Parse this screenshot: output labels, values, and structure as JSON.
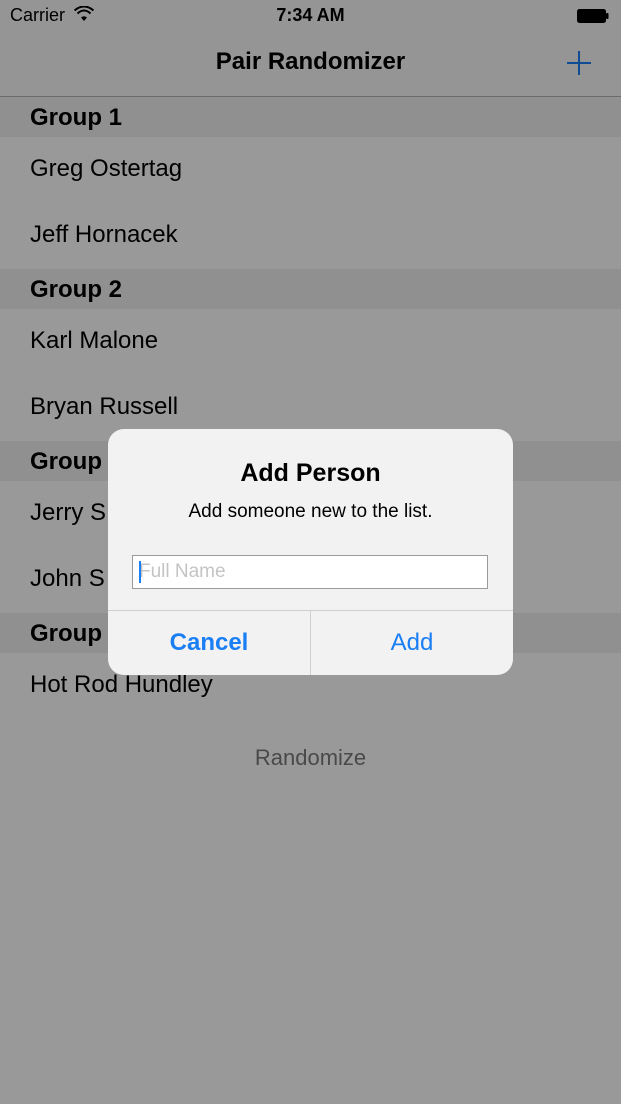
{
  "status_bar": {
    "carrier": "Carrier",
    "time": "7:34 AM"
  },
  "nav": {
    "title": "Pair Randomizer",
    "add_icon": "plus-icon"
  },
  "groups": [
    {
      "title": "Group 1",
      "members": [
        "Greg Ostertag",
        "Jeff Hornacek"
      ]
    },
    {
      "title": "Group 2",
      "members": [
        "Karl Malone",
        "Bryan Russell"
      ]
    },
    {
      "title": "Group",
      "members": [
        "Jerry S",
        "John S"
      ]
    },
    {
      "title": "Group",
      "members": [
        "Hot Rod Hundley"
      ]
    }
  ],
  "randomize_label": "Randomize",
  "alert": {
    "title": "Add Person",
    "message": "Add someone new to the list.",
    "input_placeholder": "Full Name",
    "input_value": "",
    "cancel_label": "Cancel",
    "add_label": "Add"
  },
  "colors": {
    "accent": "#1a7ff5",
    "overlay": "rgba(0,0,0,0.4)"
  }
}
